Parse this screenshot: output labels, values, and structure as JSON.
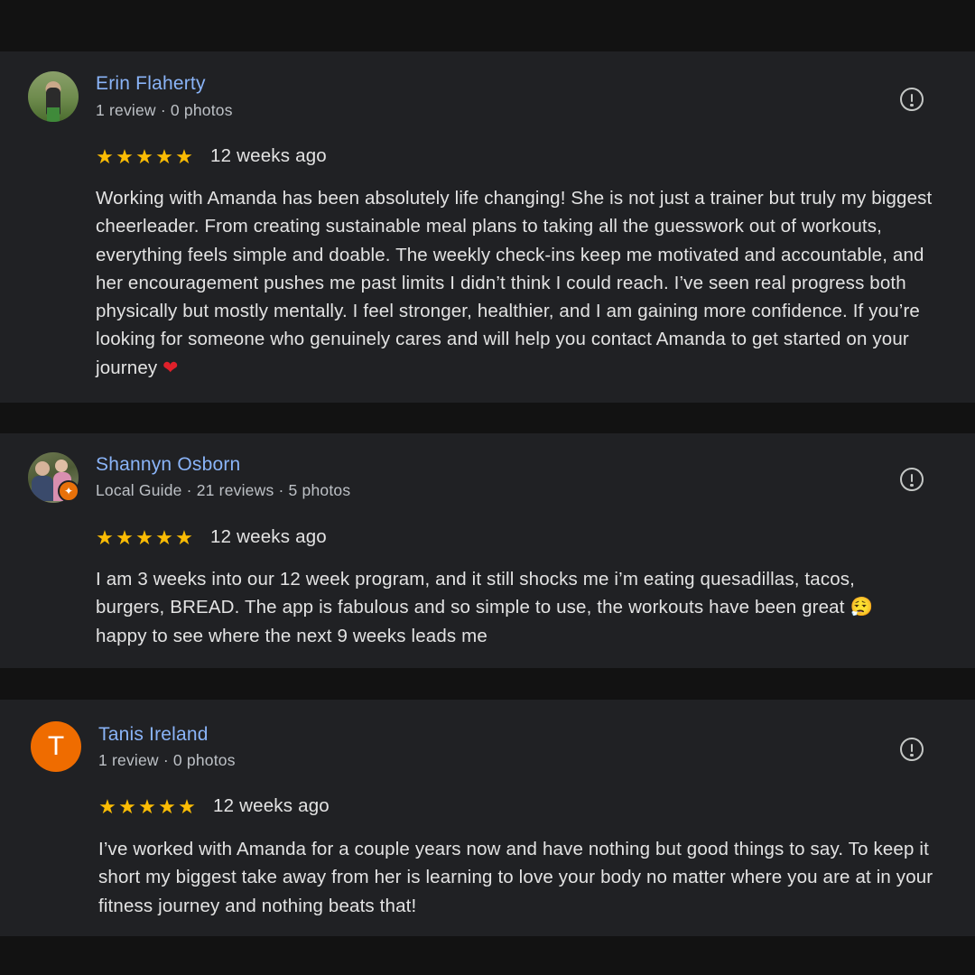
{
  "reviews": [
    {
      "name": "Erin Flaherty",
      "meta": "1 review · 0 photos",
      "rating": 5,
      "time": "12 weeks ago",
      "text": "Working with Amanda has been absolutely life changing! She is not just a trainer but truly my biggest cheerleader. From creating sustainable meal plans to taking all the guesswork out of workouts, everything feels simple and doable. The weekly check-ins keep me motivated and accountable, and her encouragement pushes me past limits I didn’t think I could reach. I’ve seen real progress both physically but mostly mentally. I feel stronger, healthier, and I am gaining more confidence. If you’re looking for someone who genuinely cares and will help you contact Amanda to get started on your journey",
      "emoji": "❤"
    },
    {
      "name": "Shannyn Osborn",
      "meta": "Local Guide · 21 reviews · 5 photos",
      "rating": 5,
      "time": "12 weeks ago",
      "text_line1": "I am 3 weeks into our 12 week program, and it still shocks me i’m eating quesadillas, tacos,",
      "text_line2": "burgers, BREAD. The app is fabulous and so simple to use, the workouts have been great",
      "emoji": "😮‍💨",
      "text_line3": "happy to see where the next 9 weeks leads me"
    },
    {
      "name": "Tanis Ireland",
      "avatar_letter": "T",
      "meta": "1 review · 0 photos",
      "rating": 5,
      "time": "12 weeks ago",
      "text": "I’ve worked with Amanda for a couple years now and have nothing but good things to say. To keep it short my biggest take away from her is learning to love your body no matter where you are at in your fitness journey and nothing beats that!"
    }
  ],
  "icons": {
    "star": "★",
    "flag": "report-flag-icon"
  },
  "colors": {
    "background": "#121212",
    "card": "#202124",
    "name": "#8ab4f8",
    "star": "#fbbc04",
    "avatar_orange": "#ef6c00"
  }
}
